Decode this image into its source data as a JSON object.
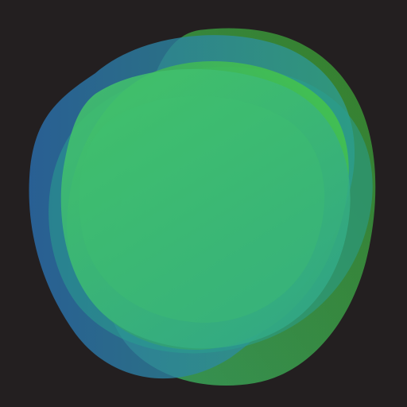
{
  "app_icon": {
    "icon_name": "translucent-overlapping-blobs-icon",
    "background_color": "#231f20",
    "palette": {
      "blue": "#2a6fb0",
      "teal": "#2aa08e",
      "green": "#46c45c",
      "lime": "#4cd13a",
      "dark_green": "#3a8f2e"
    }
  }
}
